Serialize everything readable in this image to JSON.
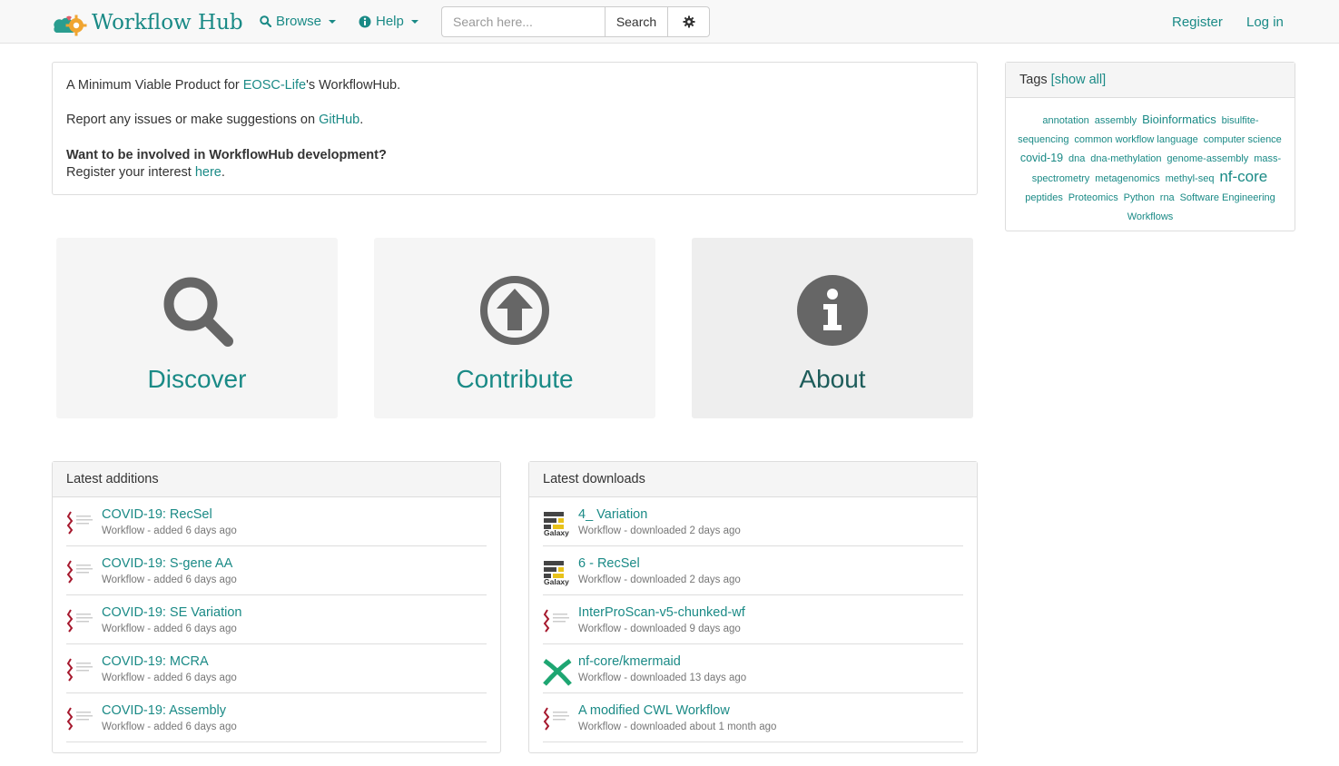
{
  "brand": {
    "title": "Workflow Hub"
  },
  "nav": {
    "browse_label": "Browse",
    "help_label": "Help",
    "search_placeholder": "Search here...",
    "search_button": "Search",
    "register_label": "Register",
    "login_label": "Log in"
  },
  "intro": {
    "line1_pre": "A Minimum Viable Product for ",
    "line1_link": "EOSC-Life",
    "line1_post": "'s WorkflowHub.",
    "line2_pre": "Report any issues or make suggestions on ",
    "line2_link": "GitHub",
    "line2_post": ".",
    "line3_bold": "Want to be involved in WorkflowHub development?",
    "line4_pre": "Register your interest ",
    "line4_link": "here",
    "line4_post": "."
  },
  "tags": {
    "heading": "Tags",
    "show_all": "[show all]",
    "items": [
      {
        "label": "annotation",
        "size": 11
      },
      {
        "label": "assembly",
        "size": 11
      },
      {
        "label": "Bioinformatics",
        "size": 13
      },
      {
        "label": "bisulfite-sequencing",
        "size": 11
      },
      {
        "label": "common workflow language",
        "size": 11
      },
      {
        "label": "computer science",
        "size": 11
      },
      {
        "label": "covid-19",
        "size": 12.5
      },
      {
        "label": "dna",
        "size": 11
      },
      {
        "label": "dna-methylation",
        "size": 11
      },
      {
        "label": "genome-assembly",
        "size": 11
      },
      {
        "label": "mass-spectrometry",
        "size": 11
      },
      {
        "label": "metagenomics",
        "size": 11
      },
      {
        "label": "methyl-seq",
        "size": 11
      },
      {
        "label": "nf-core",
        "size": 17
      },
      {
        "label": "peptides",
        "size": 11
      },
      {
        "label": "Proteomics",
        "size": 11
      },
      {
        "label": "Python",
        "size": 11
      },
      {
        "label": "rna",
        "size": 11
      },
      {
        "label": "Software Engineering",
        "size": 11
      },
      {
        "label": "Workflows",
        "size": 11
      }
    ]
  },
  "tiles": {
    "discover": "Discover",
    "contribute": "Contribute",
    "about": "About"
  },
  "latest_additions": {
    "heading": "Latest additions",
    "items": [
      {
        "title": "COVID-19: RecSel",
        "sub": "Workflow - added 6 days ago",
        "icon": "cwl-icon"
      },
      {
        "title": "COVID-19: S-gene AA",
        "sub": "Workflow - added 6 days ago",
        "icon": "cwl-icon"
      },
      {
        "title": "COVID-19: SE Variation",
        "sub": "Workflow - added 6 days ago",
        "icon": "cwl-icon"
      },
      {
        "title": "COVID-19: MCRA",
        "sub": "Workflow - added 6 days ago",
        "icon": "cwl-icon"
      },
      {
        "title": "COVID-19: Assembly",
        "sub": "Workflow - added 6 days ago",
        "icon": "cwl-icon"
      }
    ]
  },
  "latest_downloads": {
    "heading": "Latest downloads",
    "items": [
      {
        "title": "4_ Variation",
        "sub": "Workflow - downloaded 2 days ago",
        "icon": "galaxy-icon"
      },
      {
        "title": "6 - RecSel",
        "sub": "Workflow - downloaded 2 days ago",
        "icon": "galaxy-icon"
      },
      {
        "title": "InterProScan-v5-chunked-wf",
        "sub": "Workflow - downloaded 9 days ago",
        "icon": "cwl-icon"
      },
      {
        "title": "nf-core/kmermaid",
        "sub": "Workflow - downloaded 13 days ago",
        "icon": "nextflow-icon"
      },
      {
        "title": "A modified CWL Workflow",
        "sub": "Workflow - downloaded about 1 month ago",
        "icon": "cwl-icon"
      }
    ]
  },
  "icon_text": {
    "galaxy": "Galaxy"
  },
  "colors": {
    "accent": "#1a8a86",
    "icon_grey": "#666666",
    "cwl_red": "#a6192e"
  }
}
